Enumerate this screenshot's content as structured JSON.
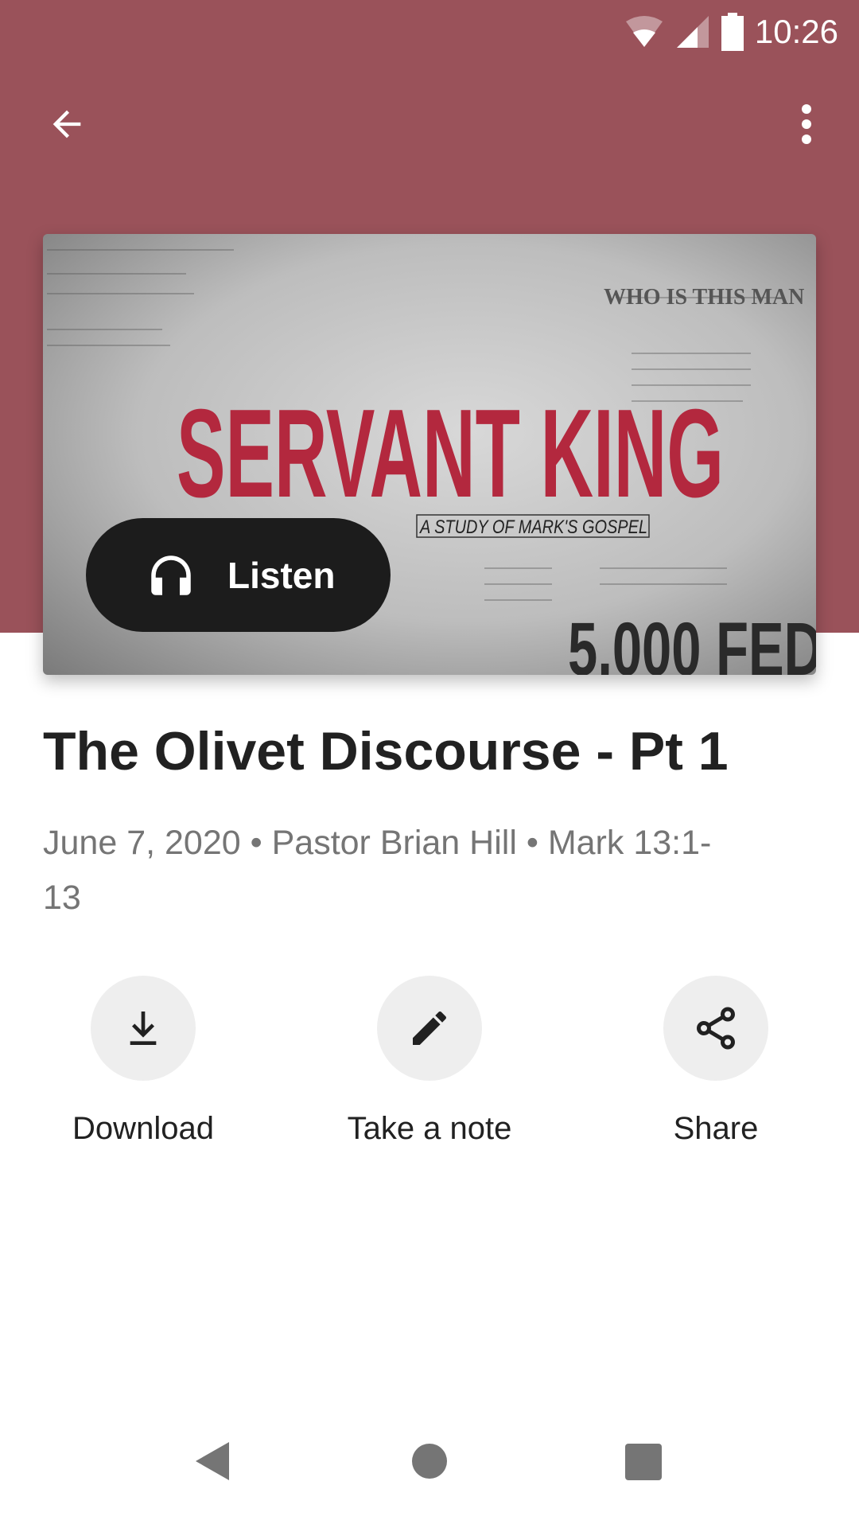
{
  "colors": {
    "header": "#9a525a",
    "listen_button": "#1c1c1c",
    "action_circle": "#eeeeee",
    "meta_text": "#757575"
  },
  "status_bar": {
    "time": "10:26",
    "icons": [
      "wifi-icon",
      "signal-icon",
      "battery-icon"
    ]
  },
  "toolbar": {
    "back_icon": "arrow-left-icon",
    "menu_icon": "more-vert-icon"
  },
  "artwork": {
    "title": "SERVANT KING",
    "subtitle": "A STUDY OF MARK'S GOSPEL",
    "corner_text": "WHO IS THIS MAN",
    "bottom_text": "5,000 FED"
  },
  "listen": {
    "label": "Listen",
    "icon": "headphones-icon"
  },
  "sermon": {
    "title": "The Olivet Discourse - Pt 1",
    "meta": "June 7, 2020 • Pastor Brian Hill • Mark 13:1-13"
  },
  "actions": [
    {
      "label": "Download",
      "icon": "download-icon"
    },
    {
      "label": "Take a note",
      "icon": "pencil-icon"
    },
    {
      "label": "Share",
      "icon": "share-icon"
    }
  ],
  "navbar": {
    "icons": [
      "nav-back-icon",
      "nav-home-icon",
      "nav-recents-icon"
    ]
  }
}
